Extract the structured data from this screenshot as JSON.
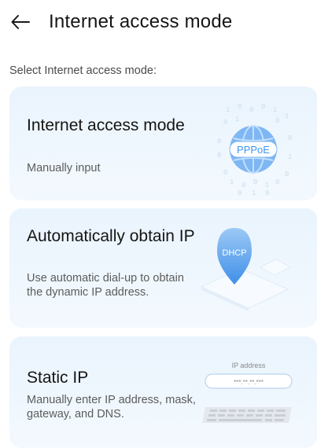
{
  "header": {
    "title": "Internet access mode"
  },
  "subtitle": "Select Internet access mode:",
  "cards": [
    {
      "title": "Internet access mode",
      "description": "Manually input",
      "badge": "PPPoE",
      "icon": "pppoe-globe-icon"
    },
    {
      "title": "Automatically obtain IP",
      "description": "Use automatic dial-up to obtain the dynamic IP address.",
      "badge": "DHCP",
      "icon": "dhcp-pin-icon"
    },
    {
      "title": "Static IP",
      "description": "Manually enter IP address, mask, gateway, and DNS.",
      "field_label": "IP address",
      "field_value": "***.**.**.***",
      "icon": "keyboard-icon"
    }
  ],
  "colors": {
    "accent": "#3c95f0",
    "card_bg": "#eaf4fd"
  }
}
